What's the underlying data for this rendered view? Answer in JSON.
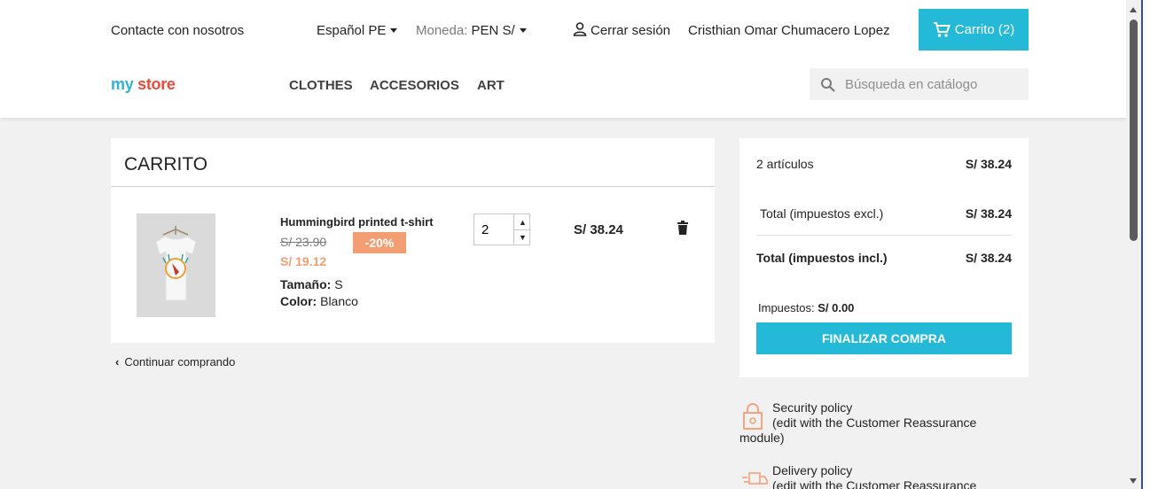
{
  "topbar": {
    "contact": "Contacte con nosotros",
    "language": "Español PE",
    "currency_label": "Moneda:",
    "currency_value": "PEN S/",
    "logout": "Cerrar sesión",
    "user_name": "Cristhian Omar Chumacero Lopez",
    "cart_label": "Carrito (2)"
  },
  "header": {
    "logo_part1": "my",
    "logo_part2": "store",
    "nav": [
      "CLOTHES",
      "ACCESORIOS",
      "ART"
    ],
    "search_placeholder": "Búsqueda en catálogo"
  },
  "cart": {
    "title": "CARRITO",
    "item": {
      "name": "Hummingbird printed t-shirt",
      "regular_price": "S/ 23.90",
      "discount": "-20%",
      "price": "S/ 19.12",
      "size_label": "Tamaño:",
      "size_value": "S",
      "color_label": "Color:",
      "color_value": "Blanco",
      "quantity": "2",
      "line_total": "S/ 38.24"
    },
    "continue": "Continuar comprando"
  },
  "summary": {
    "items_label": "2 artículos",
    "items_value": "S/ 38.24",
    "total_excl_label": "Total (impuestos excl.)",
    "total_excl_value": "S/ 38.24",
    "total_incl_label": "Total (impuestos incl.)",
    "total_incl_value": "S/ 38.24",
    "tax_label": "Impuestos:",
    "tax_value": "S/ 0.00",
    "checkout": "FINALIZAR COMPRA"
  },
  "reassurance": [
    {
      "title": "Security policy",
      "line2": "(edit with the Customer Reassurance",
      "line3": "module)"
    },
    {
      "title": "Delivery policy",
      "line2": "(edit with the Customer Reassurance"
    }
  ],
  "colors": {
    "accent": "#24b9d7",
    "discount": "#f39d72"
  }
}
